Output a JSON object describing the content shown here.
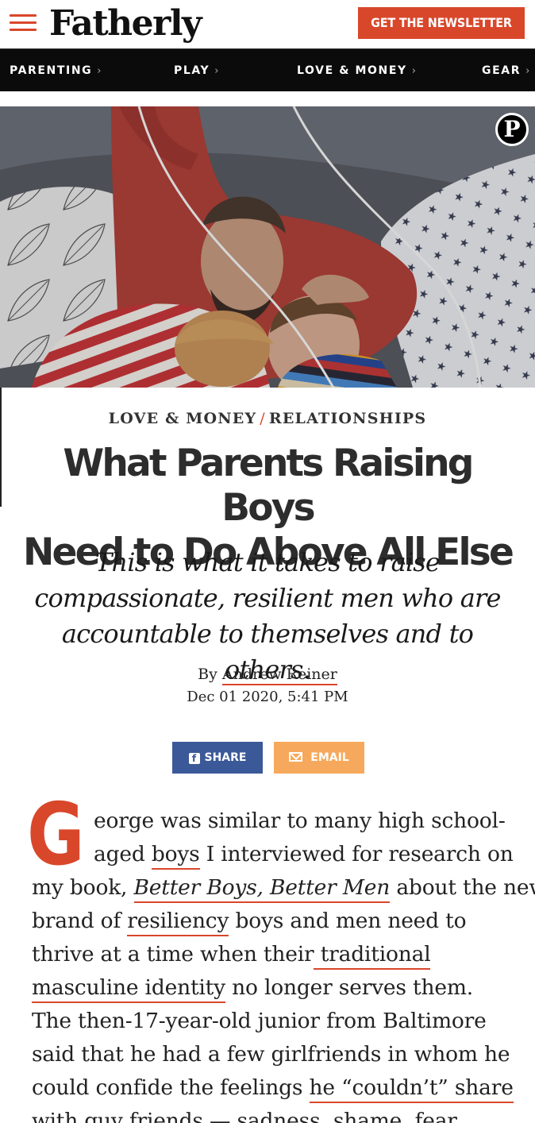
{
  "header": {
    "logo": "Fatherly",
    "newsletter_label": "GET THE NEWSLETTER"
  },
  "nav": {
    "items": [
      {
        "label": "PARENTING",
        "chevron": "›"
      },
      {
        "label": "PLAY",
        "chevron": "›"
      },
      {
        "label": "LOVE & MONEY",
        "chevron": "›"
      },
      {
        "label": "GEAR",
        "chevron": "›"
      }
    ]
  },
  "hero": {
    "pin_glyph": "P"
  },
  "article": {
    "category": "LOVE & MONEY",
    "category_sep": "/",
    "subcategory": "RELATIONSHIPS",
    "title_line1": "What Parents Raising Boys",
    "title_line2": "Need to Do Above All Else",
    "dek_line1": "This is what it takes to raise",
    "dek_line2": "compassionate, resilient men who are",
    "dek_line3": "accountable to themselves and to others.",
    "by_prefix": "By",
    "author": "Andrew Reiner",
    "date": "Dec 01 2020, 5:41 PM",
    "share_label": "SHARE",
    "share_icon": "f",
    "email_label": "EMAIL"
  },
  "body": {
    "dropcap": "G",
    "l1": "eorge was similar to many high school-",
    "l2a": "aged ",
    "l2b": "boys",
    "l2c": " I interviewed for research on",
    "l3a": "my book, ",
    "l3b": "Better Boys, Better Men",
    "l3c": " about the new",
    "l4a": "brand of ",
    "l4b": "resiliency",
    "l4c": " boys and men need to",
    "l5a": "thrive at a time when their",
    "l5b": " traditional",
    "l6a": "masculine identity",
    "l6b": " no longer serves them.",
    "l7": "The then-17-year-old junior from Baltimore",
    "l8": "said that he had a few girlfriends in whom he",
    "l9a": "could confide the feelings ",
    "l9b": "he “couldn’t” share",
    "l10": "with guy friends — sadness, shame, fear"
  }
}
